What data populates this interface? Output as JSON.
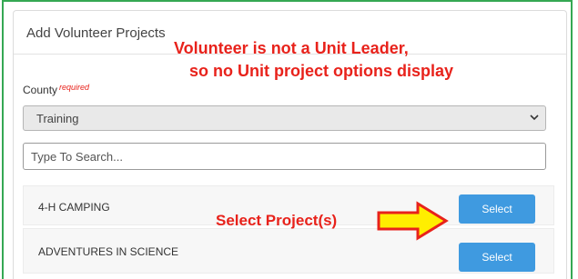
{
  "panel": {
    "title": "Add Volunteer Projects"
  },
  "annotations": {
    "note_line1": "Volunteer is not a Unit Leader,",
    "note_line2": "so no Unit project options display",
    "select_note": "Select Project(s)",
    "note_color": "#e8221b",
    "arrow_fill": "#ffee00",
    "arrow_stroke": "#e8221b"
  },
  "county": {
    "label": "County",
    "required": "required",
    "selected": "Training"
  },
  "search": {
    "placeholder": "Type To Search..."
  },
  "projects": [
    {
      "name": "4-H CAMPING",
      "button": "Select"
    },
    {
      "name": "ADVENTURES IN SCIENCE",
      "button": "Select"
    }
  ],
  "colors": {
    "frame_border": "#35a853",
    "button_bg": "#3f9ae0"
  }
}
